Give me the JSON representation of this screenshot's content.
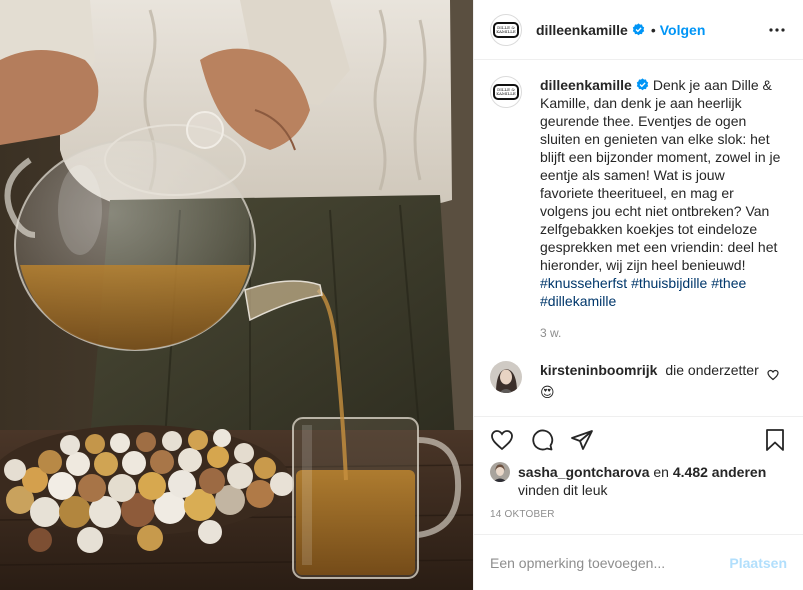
{
  "photo": {
    "description_icon": "teapot-pouring-tea-photo"
  },
  "account": {
    "username": "dilleenkamille",
    "logo_text_top": "DILLE &",
    "logo_text_bottom": "KAMILLE",
    "verified_icon": "verified-badge-icon"
  },
  "header": {
    "separator": "•",
    "follow_label": "Volgen",
    "more_icon": "more-options-icon"
  },
  "caption": {
    "username": "dilleenkamille",
    "text": "Denk je aan Dille & Kamille, dan denk je aan heerlijk geurende thee. Eventjes de ogen sluiten en genieten van elke slok: het blijft een bijzonder moment, zowel in je eentje als samen! Wat is jouw favoriete theeritueel, en mag er volgens jou echt niet ontbreken? Van zelfgebakken koekjes tot eindeloze gesprekken met een vriendin: deel het hieronder, wij zijn heel benieuwd!",
    "hashtags": [
      "#knusseherfst",
      "#thuisbijdille",
      "#thee",
      "#dillekamille"
    ],
    "time_ago": "3 w."
  },
  "comments": [
    {
      "username": "kirsteninboomrijk",
      "text": "die onderzetter",
      "emoji": "😍"
    }
  ],
  "likes": {
    "liker": "sasha_gontcharova",
    "connector": "en",
    "others": "4.482 anderen",
    "suffix": "vinden dit leuk"
  },
  "post_date": "14 OKTOBER",
  "add_comment": {
    "placeholder": "Een opmerking toevoegen...",
    "post_label": "Plaatsen"
  },
  "colors": {
    "accent": "#0095f6",
    "post_disabled": "#b2dffc",
    "hashtag": "#00376b",
    "secondary_text": "#8e8e8e"
  }
}
